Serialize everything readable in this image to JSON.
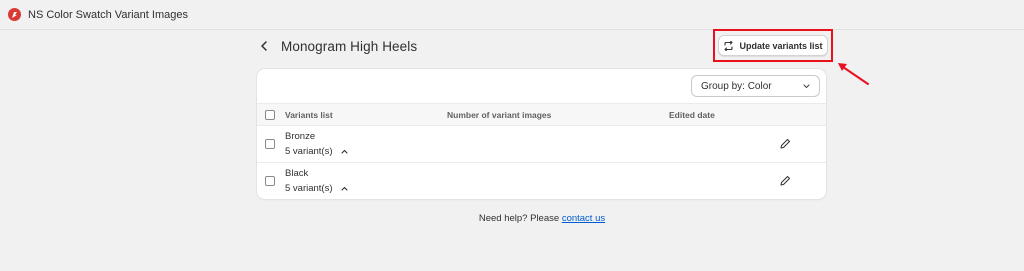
{
  "app": {
    "title": "NS Color Swatch Variant Images",
    "logo_color": "#d93a34"
  },
  "page": {
    "title": "Monogram High Heels",
    "back_icon": "chevron-left-icon"
  },
  "toolbar": {
    "update_label": "Update variants list",
    "update_icon": "refresh-icon",
    "highlight_color": "#e8111d"
  },
  "groupby": {
    "selected": "Group by: Color",
    "icon": "chevron-down-icon"
  },
  "table": {
    "columns": [
      "Variants list",
      "Number of variant images",
      "Edited date"
    ],
    "rows": [
      {
        "name": "Bronze",
        "count": "5 variant(s)"
      },
      {
        "name": "Black",
        "count": "5 variant(s)"
      }
    ]
  },
  "help": {
    "text": "Need help? Please",
    "link": "contact us",
    "link_color": "#005bd3"
  }
}
